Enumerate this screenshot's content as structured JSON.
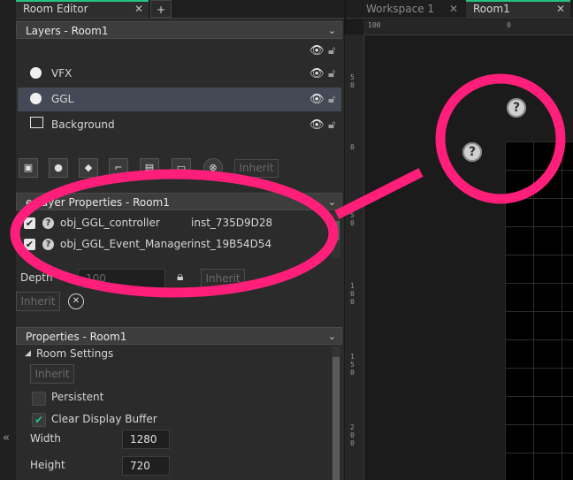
{
  "left_tabs": {
    "room_editor": "Room Editor",
    "close": "✕",
    "add": "+"
  },
  "layers": {
    "title": "Layers - Room1",
    "items": [
      {
        "label": "VFX"
      },
      {
        "label": "GGL"
      },
      {
        "label": "Background"
      }
    ],
    "toolbar_inherit": "Inherit"
  },
  "instance_props": {
    "title": "e Layer Properties - Room1",
    "instances": [
      {
        "object": "obj_GGL_controller",
        "id": "inst_735D9D28"
      },
      {
        "object": "obj_GGL_Event_Manager",
        "id": "inst_19B54D54"
      }
    ],
    "depth_label": "Depth",
    "depth_value": "100",
    "inherit_a": "Inherit",
    "inherit_b": "Inherit"
  },
  "properties": {
    "title": "Properties - Room1",
    "room_settings": "Room Settings",
    "inherit": "Inherit",
    "persistent": "Persistent",
    "clear_display_buffer": "Clear Display Buffer",
    "width_label": "Width",
    "width_value": "1280",
    "height_label": "Height",
    "height_value": "720"
  },
  "right_tabs": {
    "workspace": "Workspace 1",
    "room": "Room1",
    "close": "✕"
  },
  "ruler": {
    "h": [
      "100",
      "0"
    ],
    "v": [
      "50",
      "0",
      "50",
      "100",
      "150",
      "200"
    ]
  },
  "colors": {
    "accent": "#27c27f",
    "annotation": "#ff1f7a",
    "selected_row": "#444a55"
  }
}
